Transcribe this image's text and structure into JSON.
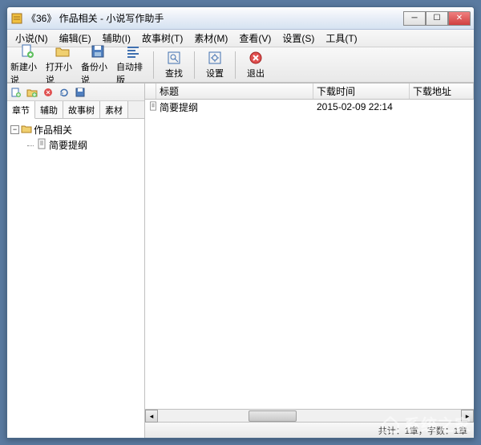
{
  "titlebar": {
    "text": "《36》 作品相关 - 小说写作助手"
  },
  "menu": {
    "items": [
      {
        "label": "小说(N)"
      },
      {
        "label": "编辑(E)"
      },
      {
        "label": "辅助(I)"
      },
      {
        "label": "故事树(T)"
      },
      {
        "label": "素材(M)"
      },
      {
        "label": "查看(V)"
      },
      {
        "label": "设置(S)"
      },
      {
        "label": "工具(T)"
      }
    ]
  },
  "toolbar": {
    "items": [
      {
        "label": "新建小说",
        "icon": "file-new"
      },
      {
        "label": "打开小说",
        "icon": "folder-open"
      },
      {
        "label": "备份小说",
        "icon": "save"
      },
      {
        "label": "自动排版",
        "icon": "align"
      }
    ],
    "items2": [
      {
        "label": "查找",
        "icon": "search"
      }
    ],
    "items3": [
      {
        "label": "设置",
        "icon": "gear"
      }
    ],
    "items4": [
      {
        "label": "退出",
        "icon": "exit"
      }
    ]
  },
  "sidebar": {
    "tabs": [
      {
        "label": "章节",
        "active": true
      },
      {
        "label": "辅助"
      },
      {
        "label": "故事树"
      },
      {
        "label": "素材"
      }
    ],
    "tree": {
      "root": {
        "label": "作品相关"
      },
      "children": [
        {
          "label": "简要提纲"
        }
      ]
    }
  },
  "list": {
    "columns": [
      {
        "label": ""
      },
      {
        "label": "标题"
      },
      {
        "label": "下载时间"
      },
      {
        "label": "下载地址"
      }
    ],
    "rows": [
      {
        "title": "简要提纲",
        "time": "2015-02-09 22:14",
        "url": ""
      }
    ]
  },
  "statusbar": {
    "text": "共计：1章，字数：1章"
  },
  "watermark": {
    "text": "系统之家"
  }
}
